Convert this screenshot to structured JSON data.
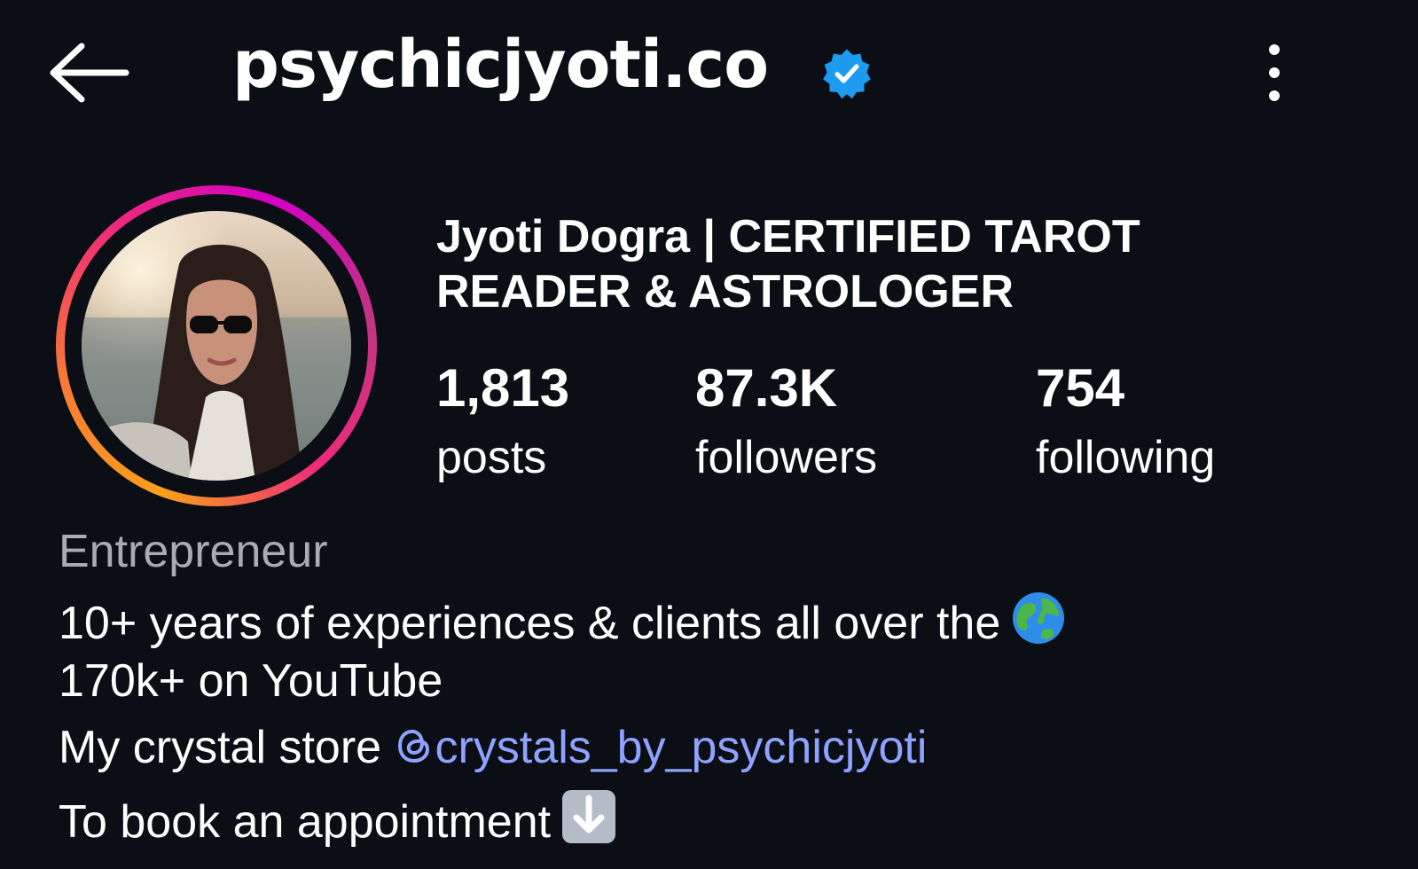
{
  "header": {
    "username": "psychicjyoti.co",
    "back_icon": "arrow-left-icon",
    "verified_icon": "verified-badge-icon",
    "more_icon": "more-vertical-icon"
  },
  "profile": {
    "full_name": "Jyoti Dogra | CERTIFIED TAROT READER & ASTROLOGER",
    "stats": {
      "posts_count": "1,813",
      "posts_label": "posts",
      "followers_count": "87.3K",
      "followers_label": "followers",
      "following_count": "754",
      "following_label": "following"
    },
    "category": "Entrepreneur",
    "bio": {
      "line1": "10+ years of experiences & clients all over the",
      "line2": "170k+ on YouTube",
      "line3_prefix": "My crystal store",
      "line3_mention": "crystals_by_psychicjyoti",
      "line4": "To book an appointment"
    }
  },
  "colors": {
    "background": "#0b0e15",
    "text": "#ffffff",
    "category": "#a8abb3",
    "mention": "#8ea2ff",
    "verified": "#1d9bf0"
  }
}
